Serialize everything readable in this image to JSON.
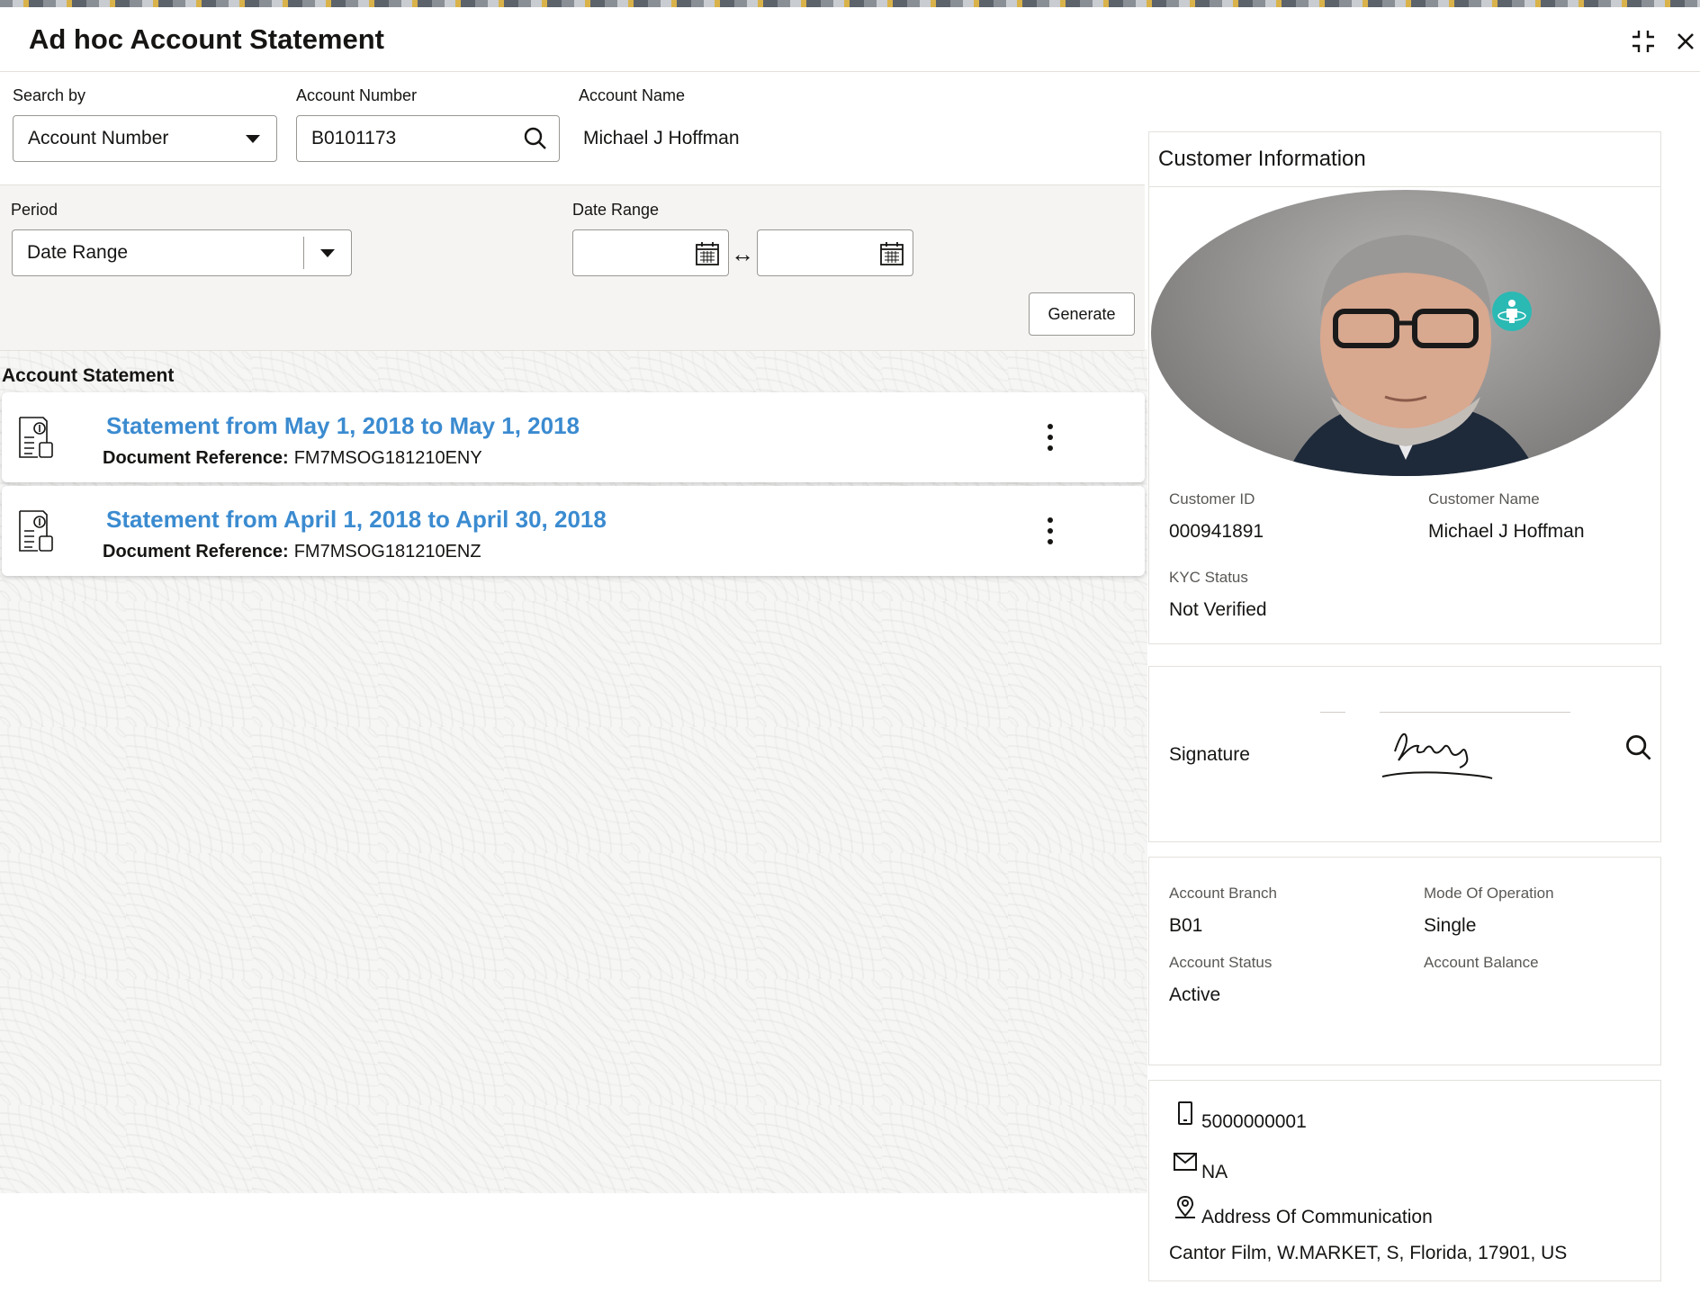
{
  "window": {
    "title": "Ad hoc Account Statement"
  },
  "search": {
    "search_by_label": "Search by",
    "search_by_value": "Account Number",
    "account_number_label": "Account Number",
    "account_number_value": "B0101173",
    "account_name_label": "Account Name",
    "account_name_value": "Michael J Hoffman"
  },
  "filter": {
    "period_label": "Period",
    "period_value": "Date Range",
    "date_range_label": "Date Range",
    "from_date": "",
    "to_date": "",
    "range_arrow": "↔",
    "generate_label": "Generate"
  },
  "statements": {
    "section_title": "Account Statement",
    "doc_ref_label": "Document Reference:",
    "items": [
      {
        "title": "Statement from May 1, 2018 to May 1, 2018",
        "reference": "FM7MSOG181210ENY"
      },
      {
        "title": "Statement from April 1, 2018 to April 30, 2018",
        "reference": "FM7MSOG181210ENZ"
      }
    ]
  },
  "customer": {
    "panel_title": "Customer Information",
    "customer_id_label": "Customer ID",
    "customer_id": "000941891",
    "customer_name_label": "Customer Name",
    "customer_name": "Michael J Hoffman",
    "kyc_label": "KYC Status",
    "kyc_value": "Not Verified",
    "signature_label": "Signature",
    "account_branch_label": "Account Branch",
    "account_branch": "B01",
    "mode_label": "Mode Of Operation",
    "mode_value": "Single",
    "account_status_label": "Account Status",
    "account_status": "Active",
    "account_balance_label": "Account Balance",
    "account_balance": "",
    "phone": "5000000001",
    "email": "NA",
    "address_label": "Address Of Communication",
    "address": "Cantor Film, W.MARKET, S, Florida, 17901, US"
  },
  "colors": {
    "link": "#3b8bd0",
    "accent_badge": "#2bb9b4",
    "border": "#9a9894"
  },
  "icons": [
    "minimize-icon",
    "close-icon",
    "chevron-down-icon",
    "search-icon",
    "calendar-icon",
    "statement-document-icon",
    "more-options-icon",
    "phone-icon",
    "email-icon",
    "location-icon",
    "view-360-icon"
  ]
}
